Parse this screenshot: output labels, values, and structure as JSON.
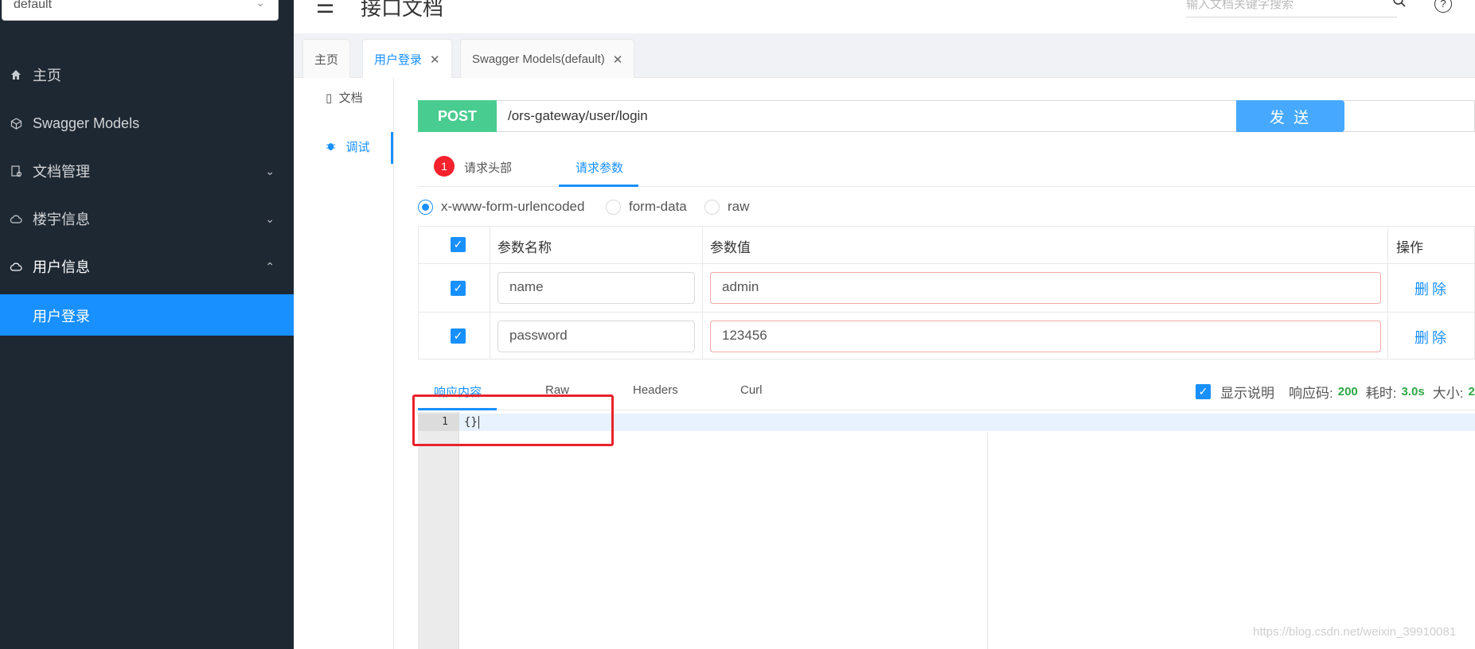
{
  "sidebar": {
    "group_select": "default",
    "items": [
      {
        "label": "主页",
        "icon": "home-icon"
      },
      {
        "label": "Swagger Models",
        "icon": "cube-icon"
      },
      {
        "label": "文档管理",
        "icon": "doc-settings-icon"
      },
      {
        "label": "楼宇信息",
        "icon": "cloud-icon"
      },
      {
        "label": "用户信息",
        "icon": "cloud-icon"
      }
    ],
    "active_sub": "用户登录"
  },
  "header": {
    "title": "接口文档",
    "search_placeholder": "输入文档关键字搜索"
  },
  "tabs": [
    {
      "label": "主页"
    },
    {
      "label": "用户登录"
    },
    {
      "label": "Swagger Models(default)"
    }
  ],
  "side_tabs": {
    "doc": "文档",
    "debug": "调试"
  },
  "request": {
    "method": "POST",
    "url": "/ors-gateway/user/login",
    "send_label": "发 送",
    "header_badge": "1",
    "tab_headers": "请求头部",
    "tab_params": "请求参数"
  },
  "content_types": [
    "x-www-form-urlencoded",
    "form-data",
    "raw"
  ],
  "params_table": {
    "col_name": "参数名称",
    "col_value": "参数值",
    "col_action": "操作",
    "rows": [
      {
        "name": "name",
        "value": "admin",
        "action": "删除"
      },
      {
        "name": "password",
        "value": "123456",
        "action": "删除"
      }
    ]
  },
  "response": {
    "tabs": [
      "响应内容",
      "Raw",
      "Headers",
      "Curl"
    ],
    "show_desc": "显示说明",
    "code_label": "响应码:",
    "code": "200",
    "time_label": "耗时:",
    "time": "3.0s",
    "size_label": "大小:",
    "size": "2",
    "line_number": "1",
    "body": "{}"
  },
  "colors": {
    "accent": "#1890ff",
    "post": "#49cc90",
    "sidebar": "#1e2833",
    "annotation": "#e8232b"
  },
  "watermark": "https://blog.csdn.net/weixin_39910081"
}
